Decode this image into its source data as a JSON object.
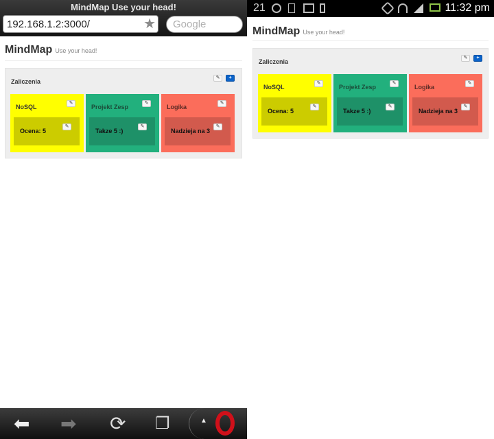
{
  "browser": {
    "title": "MindMap Use your head!",
    "url": "192.168.1.2:3000/",
    "search_placeholder": "Google"
  },
  "status_bar": {
    "notification": "21",
    "time": "11:32 pm"
  },
  "app": {
    "brand": "MindMap",
    "tagline": "Use your head!",
    "board": {
      "title": "Zaliczenia",
      "edit_icon": "pencil-icon",
      "add_label": "+",
      "columns": [
        {
          "title": "NoSQL",
          "color": "#ffff00",
          "inner_color": "#cccc00",
          "note": "Ocena: 5"
        },
        {
          "title": "Projekt Zesp",
          "color": "#22b07d",
          "inner_color": "#1e9168",
          "note": "Takze 5 :)"
        },
        {
          "title": "Logika",
          "color": "#fb6d5b",
          "inner_color": "#d25a4d",
          "note": "Nadzieja na 3"
        }
      ]
    }
  },
  "colors": {
    "well_bg": "#eeeeee",
    "primary_button": "#0b63c9",
    "opera_red": "#d0101a"
  }
}
